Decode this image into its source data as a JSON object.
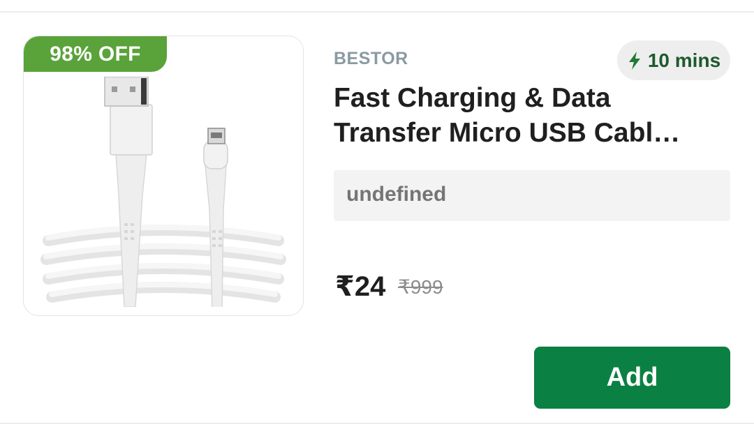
{
  "product": {
    "discount_badge": "98% OFF",
    "brand": "BESTOR",
    "delivery_time": "10 mins",
    "title": "Fast Charging & Data Transfer Micro USB Cabl…",
    "variant": "undefined",
    "price": "₹24",
    "mrp": "₹999",
    "add_label": "Add",
    "image": "white-usb-cable"
  },
  "icons": {
    "delivery": "lightning-bolt-icon"
  },
  "colors": {
    "discount_badge": "#5aa23a",
    "add_button": "#0b8043",
    "delivery_text": "#1e5a2c",
    "brand_text": "#8a9aa3"
  }
}
